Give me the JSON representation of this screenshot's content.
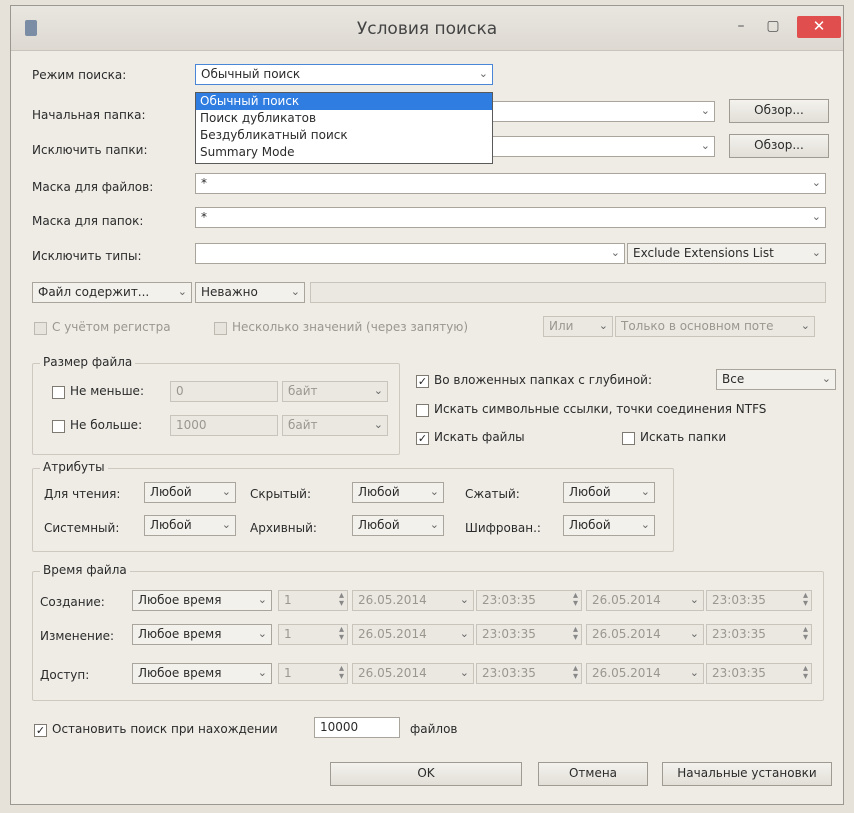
{
  "window": {
    "title": "Условия поиска",
    "min": "–",
    "max": "▢",
    "close": "✕"
  },
  "search_mode": {
    "label": "Режим поиска:",
    "value": "Обычный поиск",
    "options": [
      "Обычный поиск",
      "Поиск дубликатов",
      "Бездубликатный поиск",
      "Summary Mode"
    ],
    "selected_index": 0
  },
  "start_folder": {
    "label": "Начальная папка:",
    "value": "",
    "browse": "Обзор..."
  },
  "exclude_folders": {
    "label": "Исключить папки:",
    "value": "",
    "browse": "Обзор..."
  },
  "file_mask": {
    "label": "Маска для файлов:",
    "value": "*"
  },
  "folder_mask": {
    "label": "Маска для папок:",
    "value": "*"
  },
  "exclude_types": {
    "label": "Исключить типы:",
    "value": "",
    "list": "Exclude Extensions List"
  },
  "content": {
    "mode": "Файл содержит...",
    "relevance": "Неважно",
    "value": ""
  },
  "options": {
    "case_sensitive": "С учётом регистра",
    "multiple_values": "Несколько значений (через запятую)",
    "logic": "Или",
    "stream": "Только в основном поте"
  },
  "size": {
    "title": "Размер файла",
    "min_label": "Не меньше:",
    "min_value": "0",
    "min_unit": "байт",
    "max_label": "Не больше:",
    "max_value": "1000",
    "max_unit": "байт"
  },
  "depth": {
    "label": "Во вложенных папках с глубиной:",
    "value": "Все",
    "checked": true
  },
  "symlinks": {
    "label": "Искать символьные ссылки, точки соединения NTFS",
    "checked": false
  },
  "search_files": {
    "label": "Искать файлы",
    "checked": true
  },
  "search_folders": {
    "label": "Искать папки",
    "checked": false
  },
  "attributes": {
    "title": "Атрибуты",
    "readonly": {
      "label": "Для чтения:",
      "value": "Любой"
    },
    "hidden": {
      "label": "Скрытый:",
      "value": "Любой"
    },
    "compressed": {
      "label": "Сжатый:",
      "value": "Любой"
    },
    "system": {
      "label": "Системный:",
      "value": "Любой"
    },
    "archive": {
      "label": "Архивный:",
      "value": "Любой"
    },
    "encrypted": {
      "label": "Шифрован.:",
      "value": "Любой"
    }
  },
  "file_time": {
    "title": "Время файла",
    "rows": [
      {
        "label": "Создание:",
        "mode": "Любое время",
        "n": "1",
        "d1": "26.05.2014",
        "t1": "23:03:35",
        "d2": "26.05.2014",
        "t2": "23:03:35"
      },
      {
        "label": "Изменение:",
        "mode": "Любое время",
        "n": "1",
        "d1": "26.05.2014",
        "t1": "23:03:35",
        "d2": "26.05.2014",
        "t2": "23:03:35"
      },
      {
        "label": "Доступ:",
        "mode": "Любое время",
        "n": "1",
        "d1": "26.05.2014",
        "t1": "23:03:35",
        "d2": "26.05.2014",
        "t2": "23:03:35"
      }
    ]
  },
  "stop": {
    "label": "Остановить поиск при нахождении",
    "value": "10000",
    "suffix": "файлов",
    "checked": true
  },
  "buttons": {
    "ok": "OK",
    "cancel": "Отмена",
    "defaults": "Начальные установки"
  }
}
